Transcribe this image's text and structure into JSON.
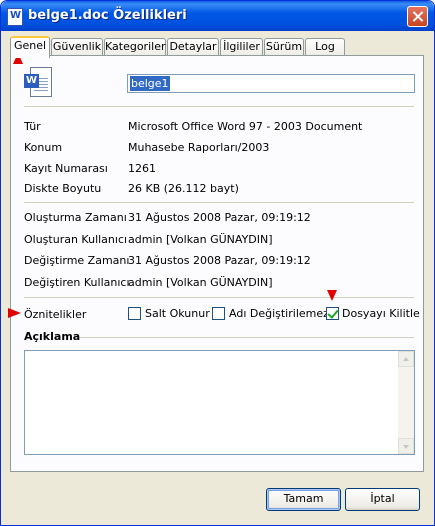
{
  "window": {
    "title": "belge1.doc Özellikleri"
  },
  "tabs": [
    {
      "label": "Genel"
    },
    {
      "label": "Güvenlik"
    },
    {
      "label": "Kategoriler"
    },
    {
      "label": "Detaylar"
    },
    {
      "label": "İlgililer"
    },
    {
      "label": "Sürüm"
    },
    {
      "label": "Log"
    }
  ],
  "file": {
    "name": "belge1"
  },
  "info": [
    {
      "label": "Tür",
      "value": "Microsoft Office Word 97 - 2003 Document"
    },
    {
      "label": "Konum",
      "value": "Muhasebe Raporları/2003"
    },
    {
      "label": "Kayıt Numarası",
      "value": "1261"
    },
    {
      "label": "Diskte Boyutu",
      "value": "26 KB (26.112 bayt)"
    }
  ],
  "history": [
    {
      "label": "Oluşturma Zamanı",
      "value": "31 Ağustos 2008 Pazar, 09:19:12"
    },
    {
      "label": "Oluşturan Kullanıcı",
      "value": "admin [Volkan GÜNAYDIN]"
    },
    {
      "label": "Değiştirme Zamanı",
      "value": "31 Ağustos 2008 Pazar, 09:19:12"
    },
    {
      "label": "Değiştiren Kullanıcı",
      "value": "admin [Volkan GÜNAYDIN]"
    }
  ],
  "attributes": {
    "label": "Öznitelikler",
    "options": [
      {
        "label": "Salt Okunur",
        "checked": false
      },
      {
        "label": "Adı Değiştirilemez",
        "checked": false
      },
      {
        "label": "Dosyayı Kilitle",
        "checked": true
      }
    ]
  },
  "description": {
    "label": "Açıklama",
    "value": ""
  },
  "buttons": {
    "ok": "Tamam",
    "cancel": "İptal"
  },
  "colors": {
    "marker": "#e00000",
    "titlebar": "#0058e6"
  }
}
